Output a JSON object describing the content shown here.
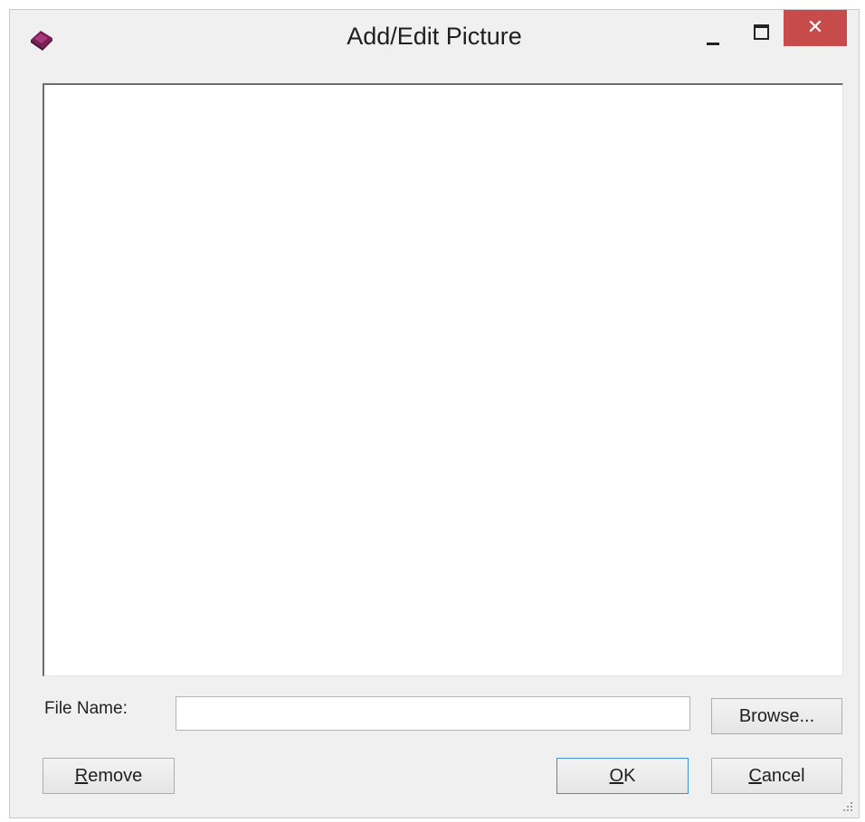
{
  "window": {
    "title": "Add/Edit Picture",
    "close_glyph": "✕",
    "app_icon": "book-icon",
    "colors": {
      "close_button": "#c84b4b",
      "default_button_border": "#3c8fd6",
      "background": "#f0f0f0"
    }
  },
  "form": {
    "file_name_label": "File Name:",
    "file_name_value": "",
    "file_name_placeholder": ""
  },
  "buttons": {
    "browse": "Browse...",
    "remove_accel": "R",
    "remove_rest": "emove",
    "ok_accel": "O",
    "ok_rest": "K",
    "cancel_accel": "C",
    "cancel_rest": "ancel"
  }
}
